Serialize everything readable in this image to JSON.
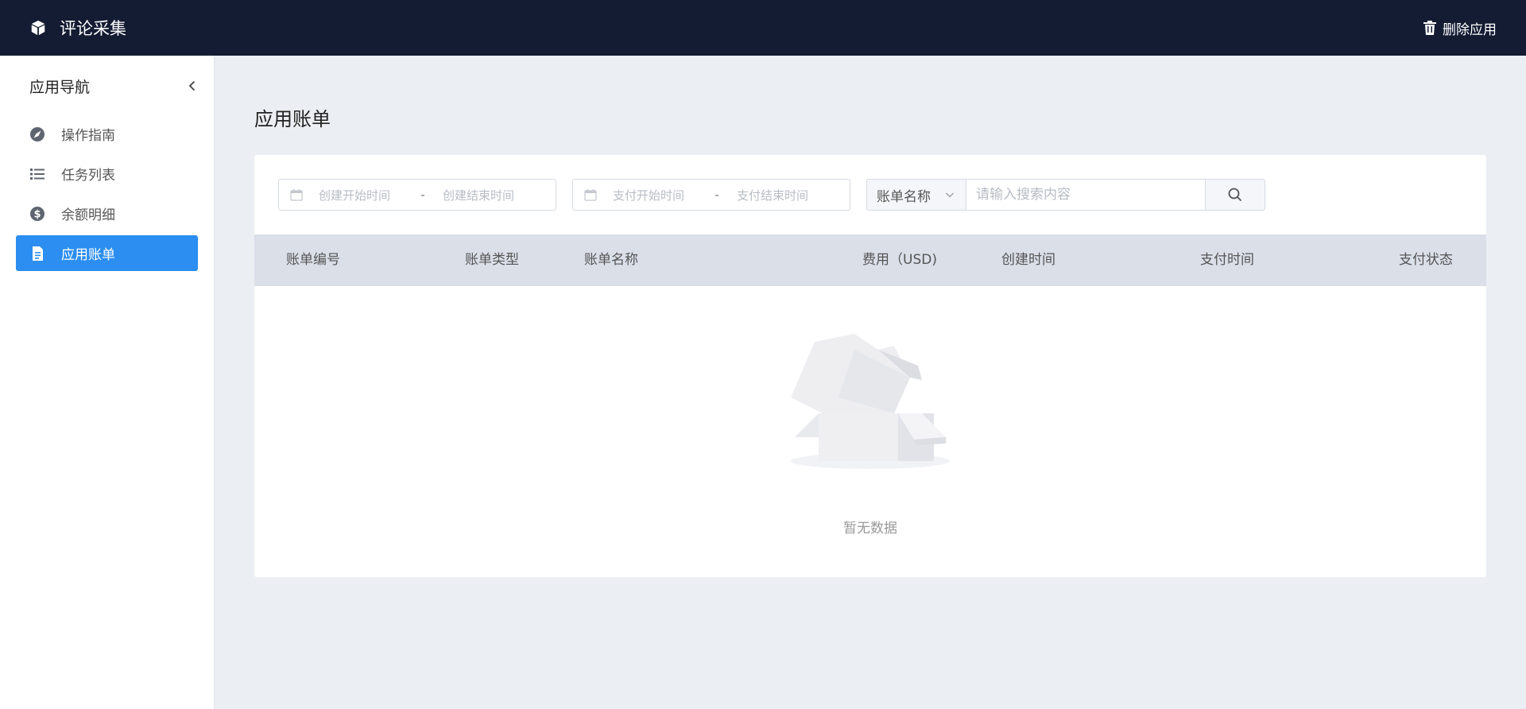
{
  "header": {
    "app_title": "评论采集",
    "delete_label": "删除应用",
    "icons": {
      "logo": "cube-icon",
      "delete": "trash-icon"
    }
  },
  "sidebar": {
    "title": "应用导航",
    "collapse_icon": "chevron-left-icon",
    "items": [
      {
        "label": "操作指南",
        "icon": "compass-icon",
        "active": false
      },
      {
        "label": "任务列表",
        "icon": "list-icon",
        "active": false
      },
      {
        "label": "余额明细",
        "icon": "dollar-icon",
        "active": false
      },
      {
        "label": "应用账单",
        "icon": "document-icon",
        "active": true
      }
    ]
  },
  "main": {
    "page_title": "应用账单",
    "filters": {
      "create_range": {
        "start_placeholder": "创建开始时间",
        "separator": "-",
        "end_placeholder": "创建结束时间"
      },
      "pay_range": {
        "start_placeholder": "支付开始时间",
        "separator": "-",
        "end_placeholder": "支付结束时间"
      },
      "search_field_select": "账单名称",
      "search_placeholder": "请输入搜索内容",
      "search_value": ""
    },
    "table": {
      "columns": [
        "账单编号",
        "账单类型",
        "账单名称",
        "费用（USD)",
        "创建时间",
        "支付时间",
        "支付状态"
      ],
      "rows": [],
      "empty_text": "暂无数据"
    }
  },
  "colors": {
    "header_bg": "#141c33",
    "accent": "#2b8ef0",
    "page_bg": "#ebeef3",
    "table_header_bg": "#dadfe8"
  }
}
